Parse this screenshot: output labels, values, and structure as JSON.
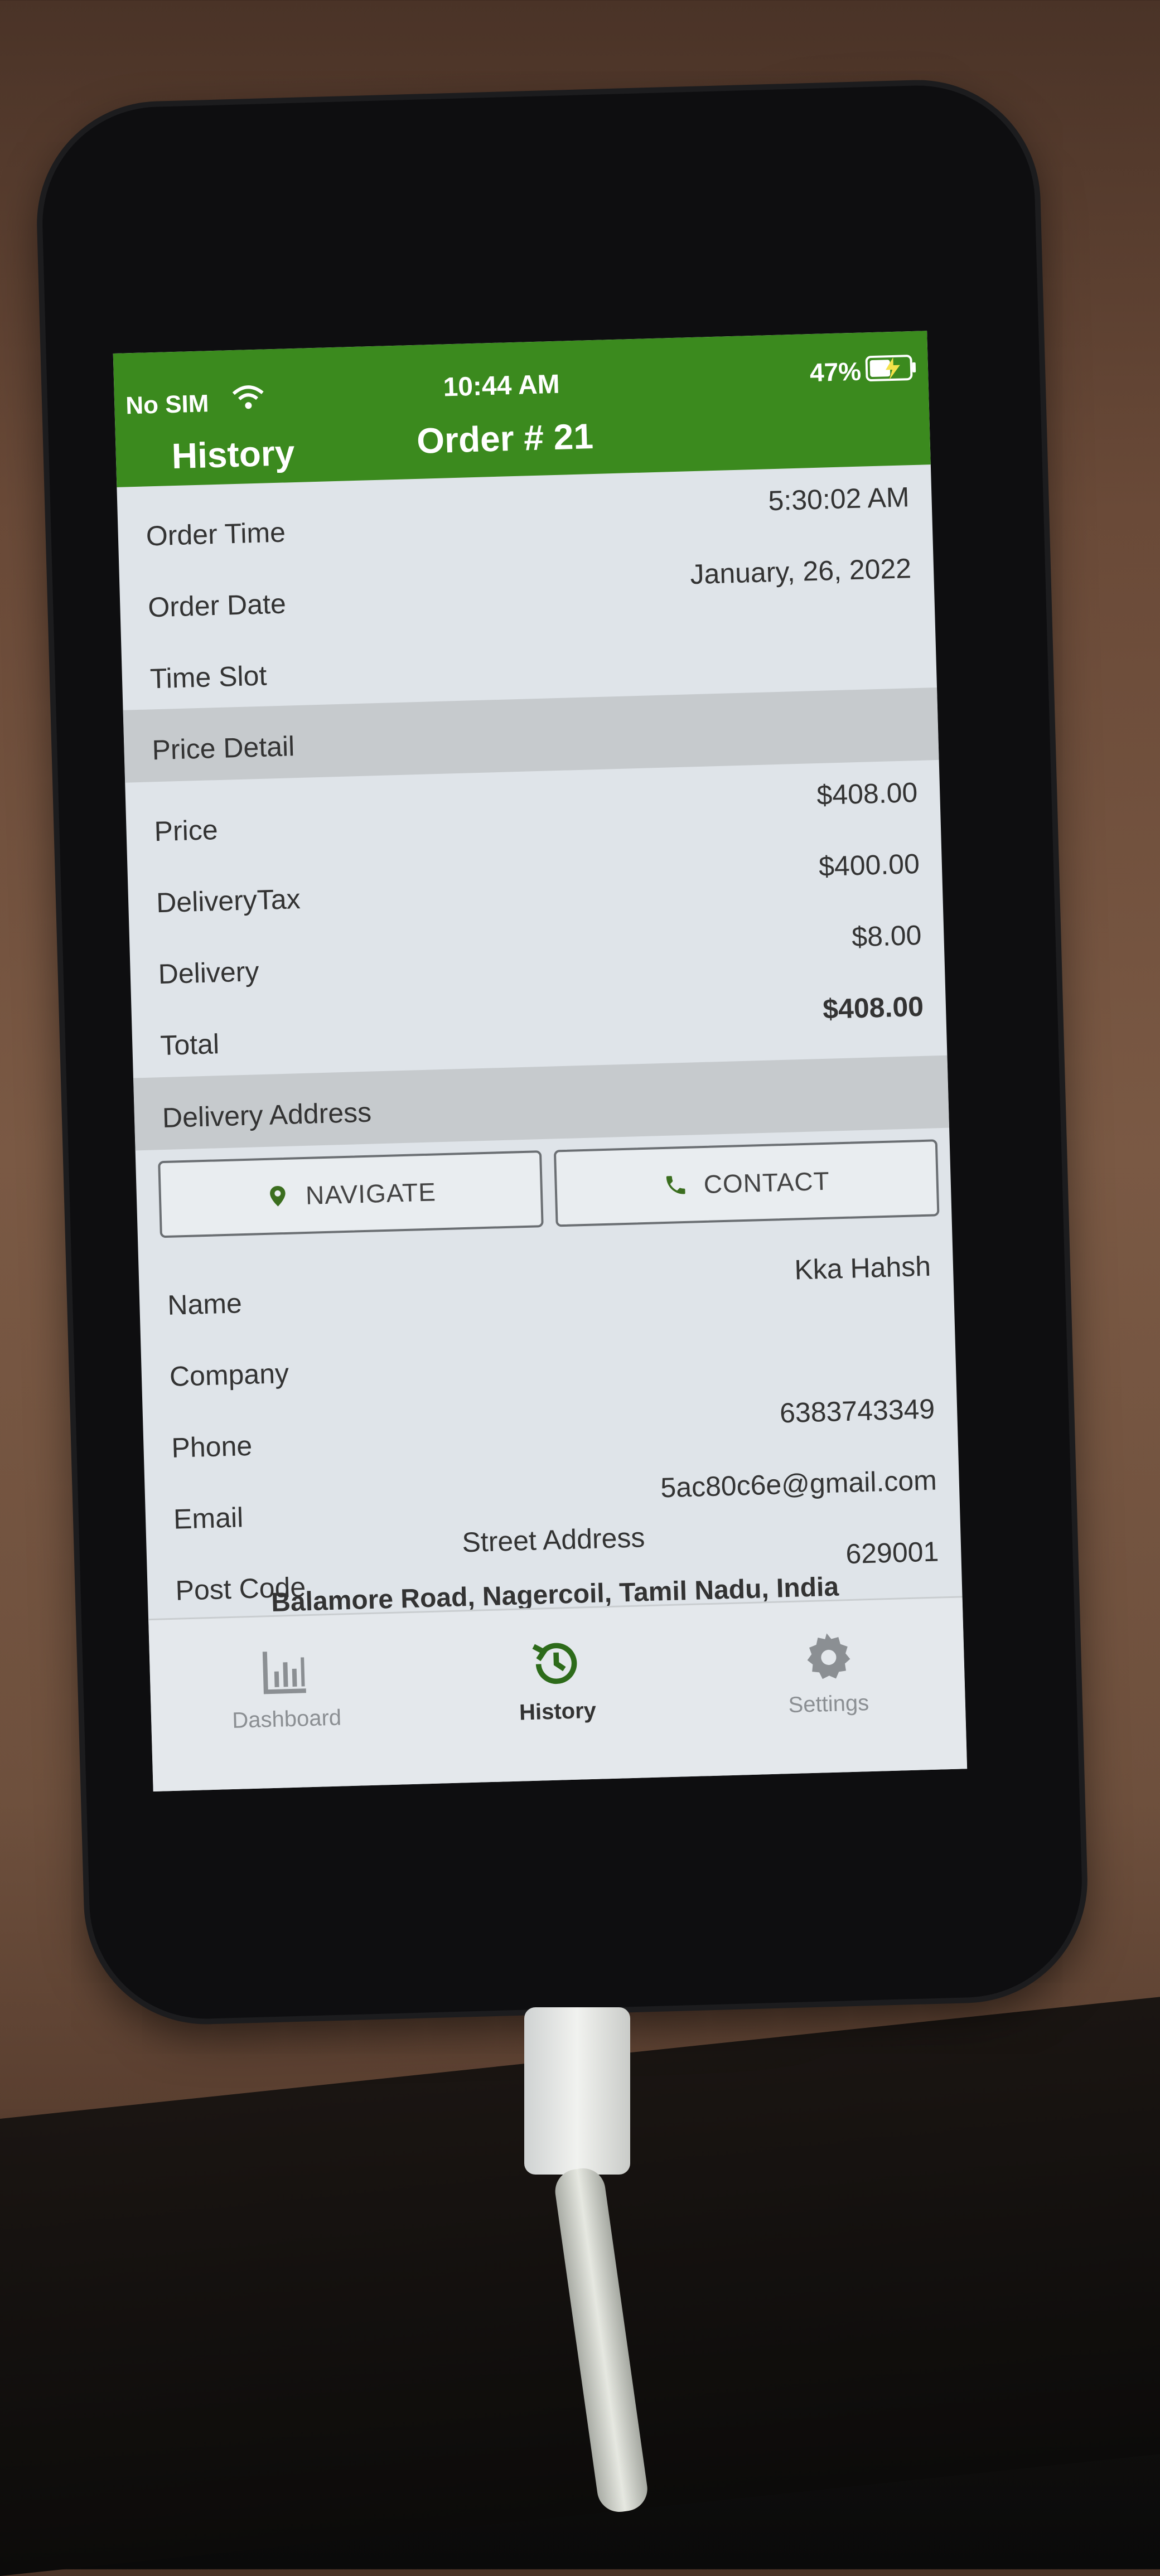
{
  "status": {
    "carrier": "No SIM",
    "time": "10:44 AM",
    "battery": "47%"
  },
  "nav": {
    "back_label": "History",
    "title": "Order # 21"
  },
  "order": {
    "order_time_label": "Order Time",
    "order_time": "5:30:02 AM",
    "order_date_label": "Order Date",
    "order_date": "January, 26, 2022",
    "time_slot_label": "Time Slot",
    "time_slot": ""
  },
  "price": {
    "section_title": "Price Detail",
    "price_label": "Price",
    "price": "$408.00",
    "delivery_tax_label": "DeliveryTax",
    "delivery_tax": "$400.00",
    "delivery_label": "Delivery",
    "delivery": "$8.00",
    "total_label": "Total",
    "total": "$408.00"
  },
  "address": {
    "section_title": "Delivery Address",
    "navigate_label": "NAVIGATE",
    "contact_label": "CONTACT",
    "name_label": "Name",
    "name": "Kka Hahsh",
    "company_label": "Company",
    "company": "",
    "phone_label": "Phone",
    "phone": "6383743349",
    "email_label": "Email",
    "email": "5ac80c6e@gmail.com",
    "post_code_label": "Post Code",
    "post_code": "629001",
    "street_label": "Street Address",
    "street": "Balamore Road, Nagercoil, Tamil Nadu, India"
  },
  "tabs": [
    {
      "label": "Dashboard",
      "icon": "bar-chart-icon"
    },
    {
      "label": "History",
      "icon": "history-icon"
    },
    {
      "label": "Settings",
      "icon": "gear-icon"
    }
  ],
  "colors": {
    "header": "#3b8a1e",
    "section": "#c6cacd",
    "navigate_icon": "#3b6e1f",
    "contact_icon": "#3b6e1f"
  }
}
